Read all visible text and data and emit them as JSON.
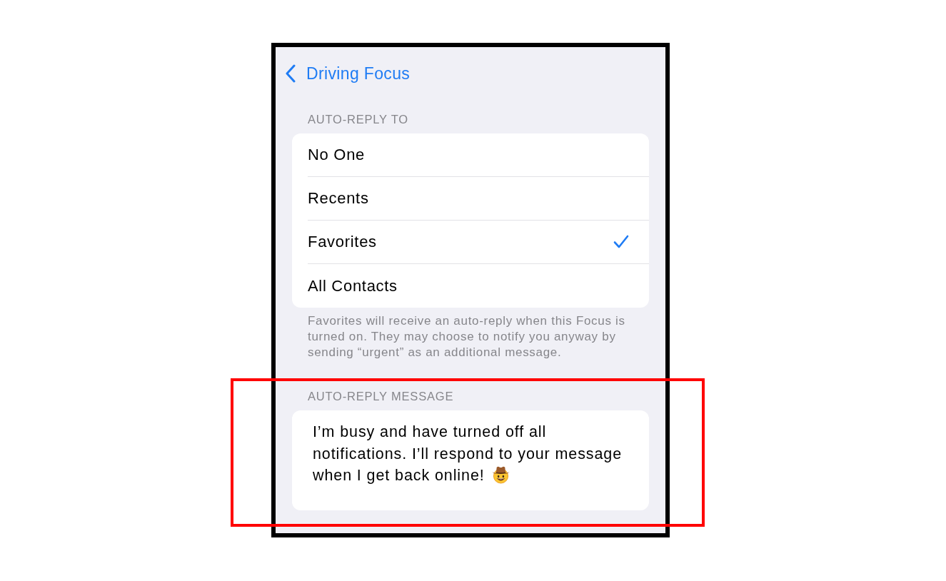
{
  "nav": {
    "back_label": "Driving Focus"
  },
  "auto_reply_to": {
    "header": "AUTO-REPLY TO",
    "options": [
      {
        "label": "No One",
        "selected": false
      },
      {
        "label": "Recents",
        "selected": false
      },
      {
        "label": "Favorites",
        "selected": true
      },
      {
        "label": "All Contacts",
        "selected": false
      }
    ],
    "footer": "Favorites will receive an auto-reply when this Focus is turned on. They may choose to notify you anyway by sending “urgent” as an additional message."
  },
  "auto_reply_message": {
    "header": "AUTO-REPLY MESSAGE",
    "value": "I’m busy and have turned off all notifications. I’ll respond to your message when I get back online!",
    "highlighted": true
  }
}
